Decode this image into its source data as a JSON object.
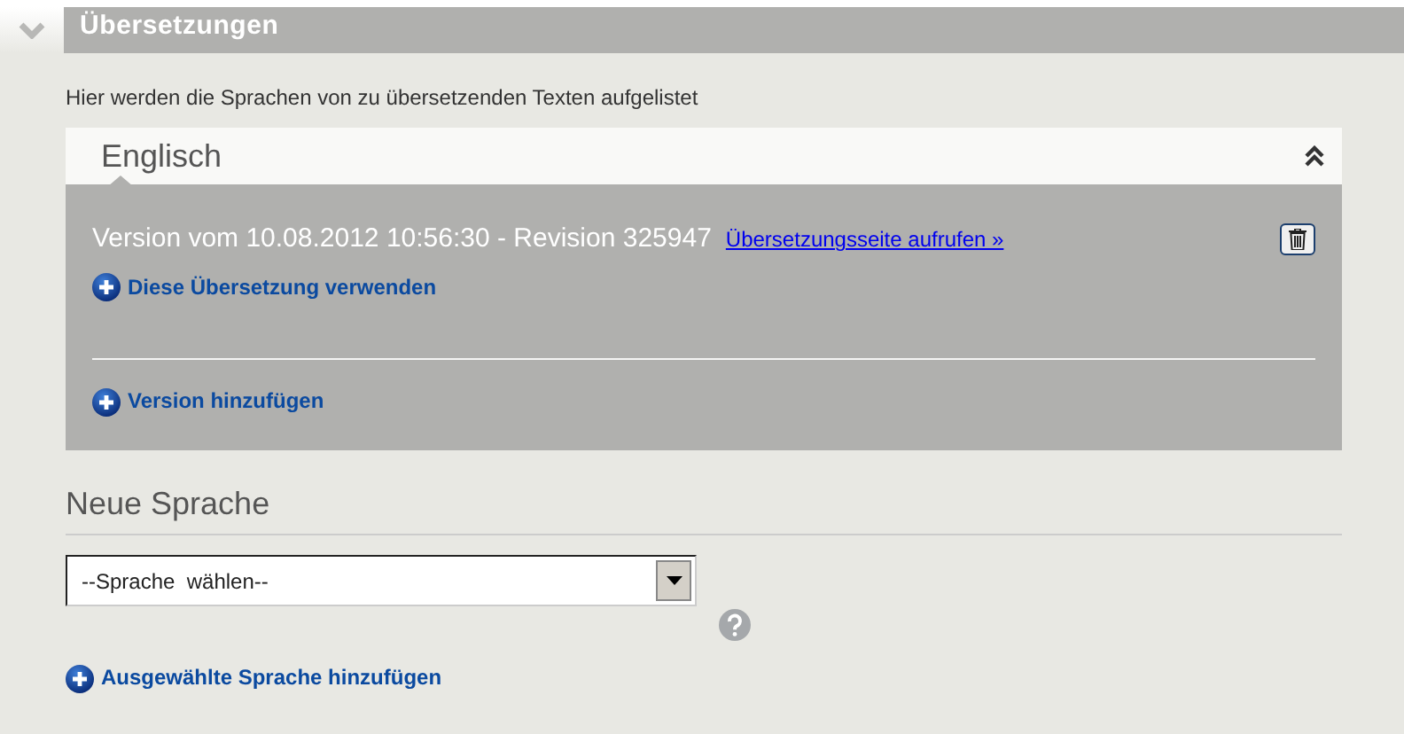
{
  "section": {
    "title": "Übersetzungen",
    "expanded": true,
    "description": "Hier werden die Sprachen von zu übersetzenden Texten aufgelistet"
  },
  "languages": [
    {
      "name": "Englisch",
      "expanded": true,
      "versions": [
        {
          "label": "Version vom 10.08.2012 10:56:30 - Revision 325947",
          "link": "Übersetzungsseite aufrufen »",
          "action": "Diese Übersetzung verwenden"
        }
      ],
      "add_version": "Version hinzufügen"
    }
  ],
  "new_language": {
    "heading": "Neue Sprache",
    "select_value": "--Sprache  wählen--",
    "add": "Ausgewählte Sprache hinzufügen"
  }
}
